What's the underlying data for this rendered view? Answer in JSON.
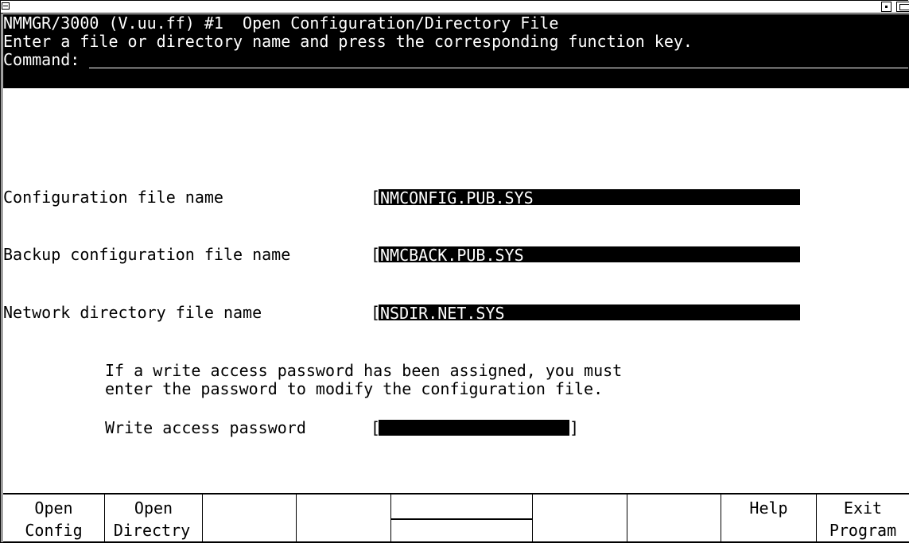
{
  "header": {
    "line1": "NMMGR/3000 (V.uu.ff) #1  Open Configuration/Directory File",
    "line2": "Enter a file or directory name and press the corresponding function key.",
    "command_label": "Command:",
    "command_value": ""
  },
  "form": {
    "config_label": "Configuration file name",
    "config_value": "NMCONFIG.PUB.SYS",
    "backup_label": "Backup configuration file name",
    "backup_value": "NMCBACK.PUB.SYS",
    "netdir_label": "Network directory file name",
    "netdir_value": "NSDIR.NET.SYS",
    "note_line1": "If a write access password has been assigned, you must",
    "note_line2": "enter the password to modify the configuration file.",
    "password_label": "Write access password",
    "password_value": "",
    "bracket_open": "[",
    "bracket_close": "]"
  },
  "function_keys": [
    {
      "line1": "Open",
      "line2": "Config"
    },
    {
      "line1": "Open",
      "line2": "Directry"
    },
    {
      "line1": "",
      "line2": ""
    },
    {
      "line1": "",
      "line2": ""
    },
    {
      "line1": "",
      "line2": ""
    },
    {
      "line1": "",
      "line2": ""
    },
    {
      "line1": "",
      "line2": ""
    },
    {
      "line1": "Help",
      "line2": ""
    },
    {
      "line1": "Exit",
      "line2": "Program"
    }
  ]
}
